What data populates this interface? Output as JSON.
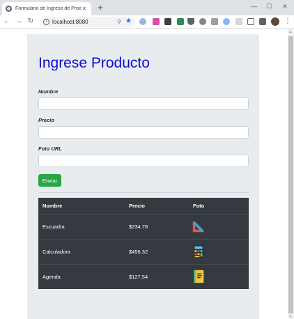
{
  "browser": {
    "tab_title": "Formulario de Ingreso de Producto",
    "tab_close": "✕",
    "new_tab": "+",
    "url": "localhost:8080",
    "window_controls": {
      "minimize": "—",
      "maximize": "☐",
      "close": "✕"
    },
    "nav": {
      "back": "←",
      "forward": "→",
      "reload": "↻"
    },
    "menu": "⋮",
    "accent": "#1a73e8"
  },
  "page": {
    "title": "Ingrese Producto",
    "title_color": "#0d0dd1",
    "form": {
      "nombre_label": "Nombre",
      "nombre_value": "",
      "precio_label": "Precio",
      "precio_value": "",
      "foto_label": "Foto URL",
      "foto_value": "",
      "submit_label": "Enviar",
      "submit_color": "#28a745"
    },
    "table": {
      "headers": [
        "Nombre",
        "Precio",
        "Foto"
      ],
      "rows": [
        {
          "nombre": "Escuadra",
          "precio": "$234.78",
          "foto_icon": "set-square-ruler-icon"
        },
        {
          "nombre": "Calculadora",
          "precio": "$456.32",
          "foto_icon": "calculator-icon"
        },
        {
          "nombre": "Agenda",
          "precio": "$127.54",
          "foto_icon": "notebook-agenda-icon"
        }
      ],
      "background": "#343a40"
    }
  }
}
